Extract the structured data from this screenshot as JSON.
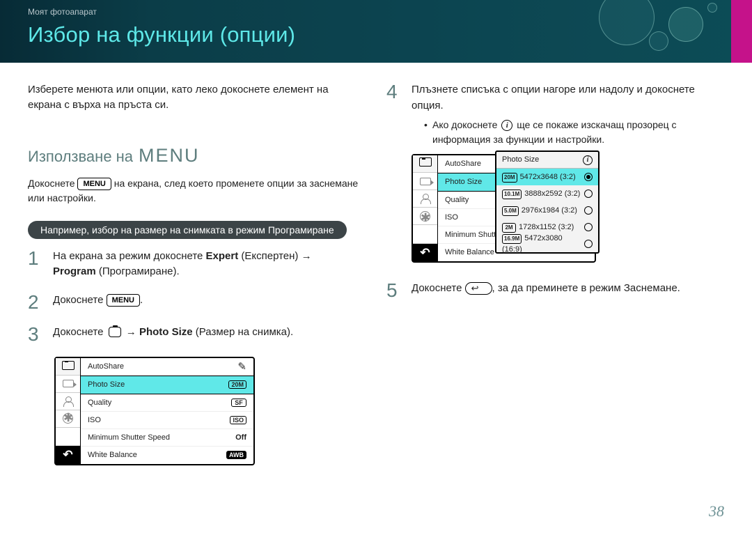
{
  "breadcrumb": "Моят фотоапарат",
  "title": "Избор на функции (опции)",
  "intro": "Изберете менюта или опции, като леко докоснете елемент на екрана с върха на пръста си.",
  "section": {
    "lead": "Използване на",
    "menu_word": "MENU"
  },
  "sub_before": "Докоснете ",
  "sub_after": " на екрана, след което променете опции за заснемане или настройки.",
  "menu_tag": "MENU",
  "pill": "Например, избор на размер на снимката в режим Програмиране",
  "steps": {
    "s1a": "На екрана за режим докоснете ",
    "s1a_bold": "Expert",
    "s1b": " (Експертен) → ",
    "s1c_bold": "Program",
    "s1d": " (Програмиране).",
    "s2a": "Докоснете ",
    "s3a": "Докоснете ",
    "s3b": " → ",
    "s3b_bold": "Photo Size",
    "s3c": " (Размер на снимка).",
    "s4": "Плъзнете списъка с опции нагоре или надолу и докоснете опция.",
    "s4_sub_a": "Ако докоснете ",
    "s4_sub_b": " ще се покаже изскачащ прозорец с информация за функции и настройки.",
    "s5a": "Докоснете ",
    "s5b": ", за да преминете в режим Заснемане."
  },
  "menu_panel": {
    "items": [
      {
        "label": "AutoShare",
        "tag": ""
      },
      {
        "label": "Photo Size",
        "tag": "20M"
      },
      {
        "label": "Quality",
        "tag": "SF"
      },
      {
        "label": "ISO",
        "tag": "ISO"
      },
      {
        "label": "Minimum Shutter Speed",
        "tag": "Off"
      },
      {
        "label": "White Balance",
        "tag": "AWB"
      }
    ],
    "items2": [
      {
        "label": "AutoShare"
      },
      {
        "label": "Photo Size"
      },
      {
        "label": "Quality"
      },
      {
        "label": "ISO"
      },
      {
        "label": "Minimum Shutter Spe"
      },
      {
        "label": "White Balance"
      }
    ],
    "popover": {
      "title": "Photo Size",
      "opts": [
        {
          "tag": "20M",
          "label": "5472x3648 (3:2)",
          "on": true
        },
        {
          "tag": "10.1M",
          "label": "3888x2592 (3:2)",
          "on": false
        },
        {
          "tag": "5.0M",
          "label": "2976x1984 (3:2)",
          "on": false
        },
        {
          "tag": "2M",
          "label": "1728x1152 (3:2)",
          "on": false
        },
        {
          "tag": "16.9M",
          "label": "5472x3080 (16:9)",
          "on": false
        }
      ]
    }
  },
  "pagenum": "38"
}
